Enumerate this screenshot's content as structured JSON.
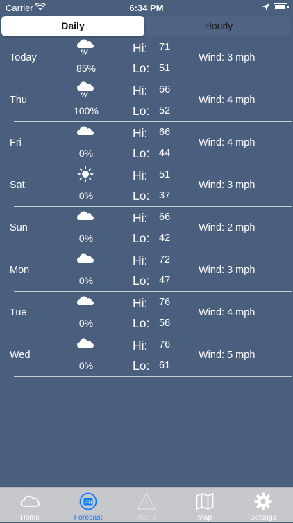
{
  "status_bar": {
    "carrier": "Carrier",
    "time": "6:34 PM"
  },
  "segmented": {
    "daily_label": "Daily",
    "hourly_label": "Hourly",
    "selected": "Daily"
  },
  "labels": {
    "hi": "Hi:",
    "lo": "Lo:"
  },
  "forecast": [
    {
      "day": "Today",
      "icon": "rain-cloud-icon",
      "precip": "85%",
      "hi": "71",
      "lo": "51",
      "wind": "Wind: 3 mph"
    },
    {
      "day": "Thu",
      "icon": "rain-cloud-icon",
      "precip": "100%",
      "hi": "66",
      "lo": "52",
      "wind": "Wind: 4 mph"
    },
    {
      "day": "Fri",
      "icon": "cloud-icon",
      "precip": "0%",
      "hi": "66",
      "lo": "44",
      "wind": "Wind: 4 mph"
    },
    {
      "day": "Sat",
      "icon": "sun-icon",
      "precip": "0%",
      "hi": "51",
      "lo": "37",
      "wind": "Wind: 3 mph"
    },
    {
      "day": "Sun",
      "icon": "cloud-icon",
      "precip": "0%",
      "hi": "66",
      "lo": "42",
      "wind": "Wind: 2 mph"
    },
    {
      "day": "Mon",
      "icon": "cloud-icon",
      "precip": "0%",
      "hi": "72",
      "lo": "47",
      "wind": "Wind: 3 mph"
    },
    {
      "day": "Tue",
      "icon": "cloud-icon",
      "precip": "0%",
      "hi": "76",
      "lo": "58",
      "wind": "Wind: 4 mph"
    },
    {
      "day": "Wed",
      "icon": "cloud-icon",
      "precip": "0%",
      "hi": "76",
      "lo": "61",
      "wind": "Wind: 5 mph"
    }
  ],
  "tabs": [
    {
      "label": "Home",
      "icon": "cloud-outline-icon",
      "state": "normal"
    },
    {
      "label": "Forecast",
      "icon": "calendar-icon",
      "state": "active"
    },
    {
      "label": "Alerts",
      "icon": "warning-icon",
      "state": "disabled"
    },
    {
      "label": "Map",
      "icon": "map-icon",
      "state": "normal"
    },
    {
      "label": "Settings",
      "icon": "gear-icon",
      "state": "normal"
    }
  ],
  "colors": {
    "background": "#4a5e7e",
    "tab_active": "#0a7aff",
    "tab_bar": "#c7c8cc"
  }
}
